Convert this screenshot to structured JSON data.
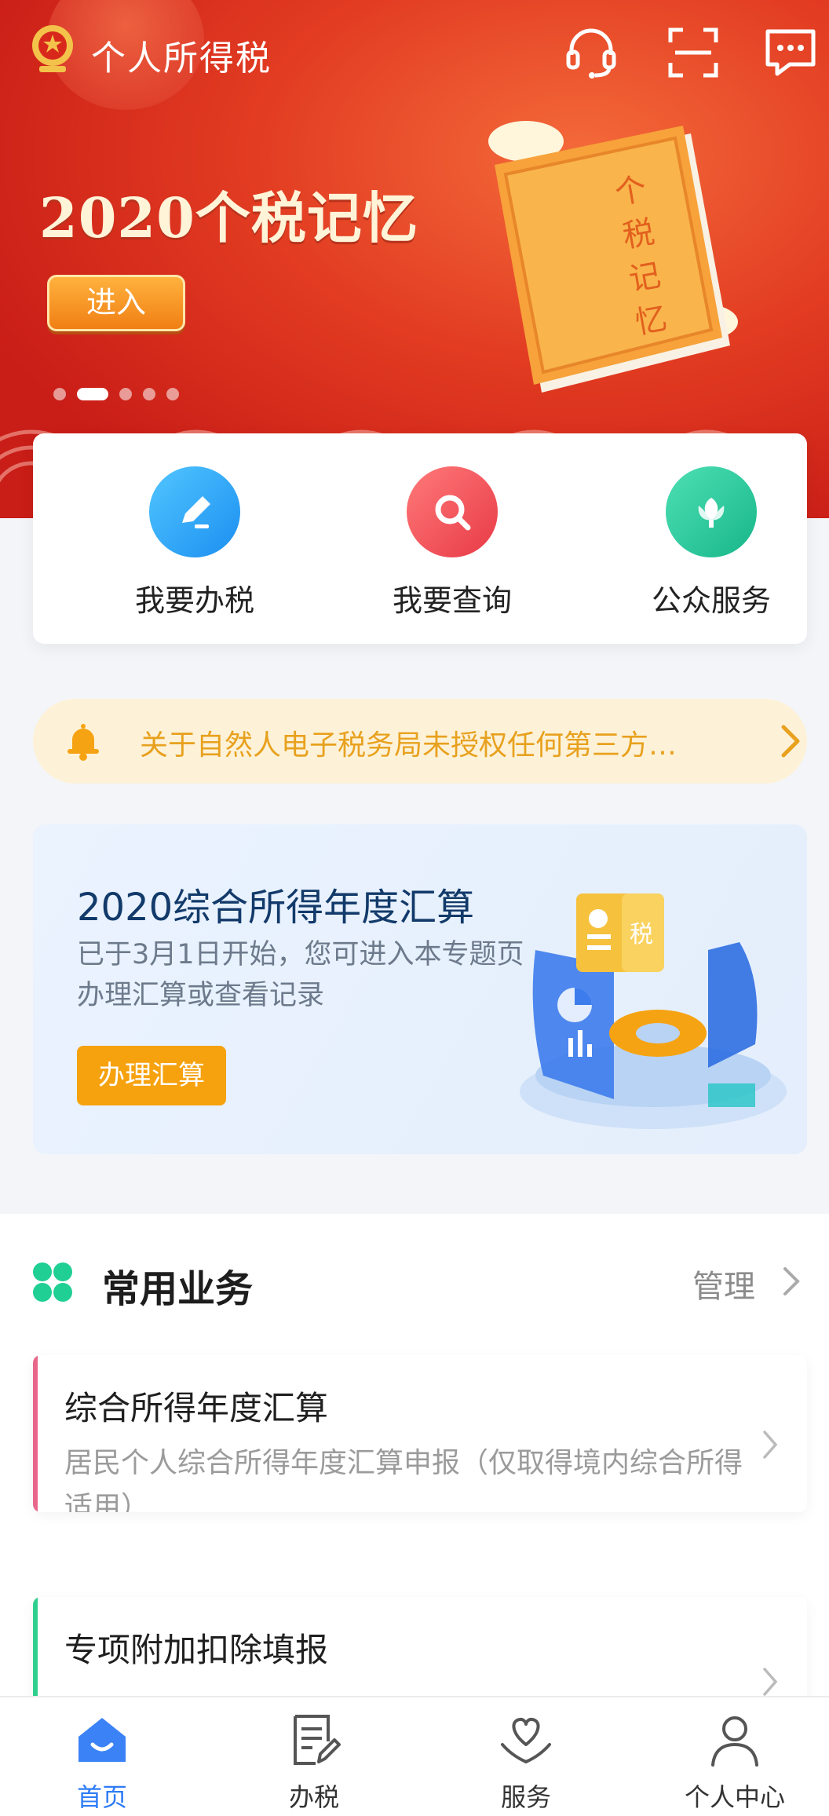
{
  "header": {
    "app_title": "个人所得税"
  },
  "banner": {
    "title": "2020个税记忆",
    "enter_label": "进入",
    "book_text": "个税记忆",
    "page_count": 5,
    "active_page": 2
  },
  "quick_actions": [
    {
      "label": "我要办税",
      "icon": "pen-icon",
      "color": "#2fa9f2"
    },
    {
      "label": "我要查询",
      "icon": "search-icon",
      "color": "#f2555a"
    },
    {
      "label": "公众服务",
      "icon": "flower-icon",
      "color": "#22c49b"
    }
  ],
  "notice": {
    "text": "关于自然人电子税务局未授权任何第三方…"
  },
  "settlement": {
    "title": "2020综合所得年度汇算",
    "desc": "已于3月1日开始，您可进入本专题页办理汇算或查看记录",
    "button": "办理汇算",
    "illus_label": "税"
  },
  "common": {
    "heading": "常用业务",
    "manage": "管理",
    "items": [
      {
        "title": "综合所得年度汇算",
        "desc": "居民个人综合所得年度汇算申报（仅取得境内综合所得适用）",
        "accent": "#e8678a"
      },
      {
        "title": "专项附加扣除填报",
        "desc": "",
        "accent": "#2fd08e"
      }
    ]
  },
  "tabs": [
    {
      "label": "首页",
      "icon": "home-icon",
      "active": true
    },
    {
      "label": "办税",
      "icon": "document-edit-icon",
      "active": false
    },
    {
      "label": "服务",
      "icon": "heart-hand-icon",
      "active": false
    },
    {
      "label": "个人中心",
      "icon": "person-icon",
      "active": false
    }
  ],
  "colors": {
    "brand_red": "#d8281c",
    "accent_blue": "#2e7cf6",
    "notice_orange": "#e8a11e",
    "settle_button": "#f6a20f"
  }
}
